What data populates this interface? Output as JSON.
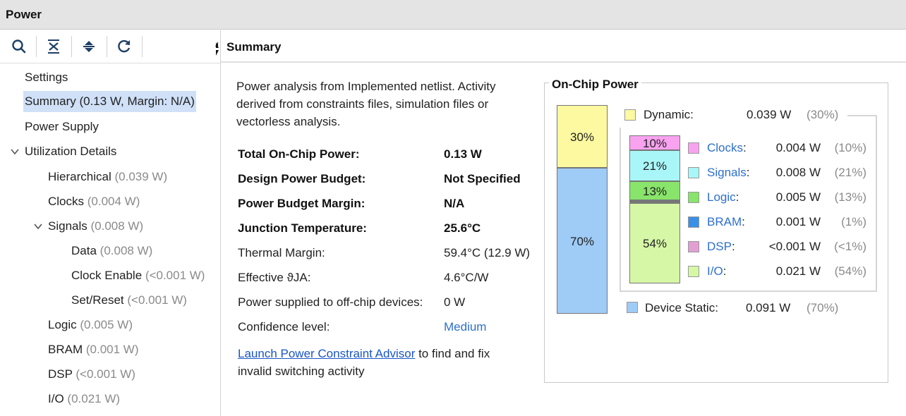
{
  "window": {
    "title": "Power"
  },
  "toolbar": {
    "icons": [
      "search-icon",
      "collapse-all-icon",
      "expand-all-icon",
      "refresh-icon"
    ]
  },
  "tree": {
    "settings": "Settings",
    "summary": {
      "label": "Summary",
      "value": "(0.13 W, Margin: N/A)"
    },
    "power_supply": "Power Supply",
    "utilization": "Utilization Details",
    "hierarchical": {
      "label": "Hierarchical",
      "value": "(0.039 W)"
    },
    "clocks": {
      "label": "Clocks",
      "value": "(0.004 W)"
    },
    "signals": {
      "label": "Signals",
      "value": "(0.008 W)"
    },
    "data": {
      "label": "Data",
      "value": "(0.008 W)"
    },
    "clock_enable": {
      "label": "Clock Enable",
      "value": "(<0.001 W)"
    },
    "set_reset": {
      "label": "Set/Reset",
      "value": "(<0.001 W)"
    },
    "logic": {
      "label": "Logic",
      "value": "(0.005 W)"
    },
    "bram": {
      "label": "BRAM",
      "value": "(0.001 W)"
    },
    "dsp": {
      "label": "DSP",
      "value": "(<0.001 W)"
    },
    "io": {
      "label": "I/O",
      "value": "(0.021 W)"
    }
  },
  "summary": {
    "header": "Summary",
    "intro": "Power analysis from Implemented netlist. Activity derived from constraints files, simulation files or vectorless analysis.",
    "rows": [
      {
        "label": "Total On-Chip Power:",
        "value": "0.13 W"
      },
      {
        "label": "Design Power Budget:",
        "value": "Not Specified"
      },
      {
        "label": "Power Budget Margin:",
        "value": "N/A"
      },
      {
        "label": "Junction Temperature:",
        "value": "25.6°C"
      },
      {
        "label": "Thermal Margin:",
        "value": "59.4°C (12.9 W)"
      },
      {
        "label": "Effective ϑJA:",
        "value": "4.6°C/W"
      },
      {
        "label": "Power supplied to off-chip devices:",
        "value": "0 W"
      },
      {
        "label": "Confidence level:",
        "value": "Medium"
      }
    ],
    "advisor_link": "Launch Power Constraint Advisor",
    "advisor_rest": " to find and fix invalid switching activity"
  },
  "onchip": {
    "title": "On-Chip Power",
    "dynamic": {
      "label": "Dynamic:",
      "value": "0.039 W",
      "pct": "(30%)",
      "bar_label": "30%",
      "share": 0.3,
      "color": "#fcf9a0"
    },
    "static": {
      "label": "Device Static:",
      "value": "0.091 W",
      "pct": "(70%)",
      "bar_label": "70%",
      "share": 0.7,
      "color": "#9fcbf7"
    },
    "items": [
      {
        "label": "Clocks",
        "value": "0.004 W",
        "pct": "(10%)",
        "bar_label": "10%",
        "share": 0.1,
        "color": "#f8a2f0"
      },
      {
        "label": "Signals",
        "value": "0.008 W",
        "pct": "(21%)",
        "bar_label": "21%",
        "share": 0.21,
        "color": "#a8f6f8"
      },
      {
        "label": "Logic",
        "value": "0.005 W",
        "pct": "(13%)",
        "bar_label": "13%",
        "share": 0.13,
        "color": "#88e46a"
      },
      {
        "label": "BRAM",
        "value": "0.001 W",
        "pct": "(1%)",
        "bar_label": "",
        "share": 0.01,
        "color": "#3a8fe6"
      },
      {
        "label": "DSP",
        "value": "<0.001 W",
        "pct": "(<1%)",
        "bar_label": "",
        "share": 0.01,
        "color": "#e29fd4"
      },
      {
        "label": "I/O",
        "value": "0.021 W",
        "pct": "(54%)",
        "bar_label": "54%",
        "share": 0.54,
        "color": "#d6f7a6"
      }
    ]
  }
}
